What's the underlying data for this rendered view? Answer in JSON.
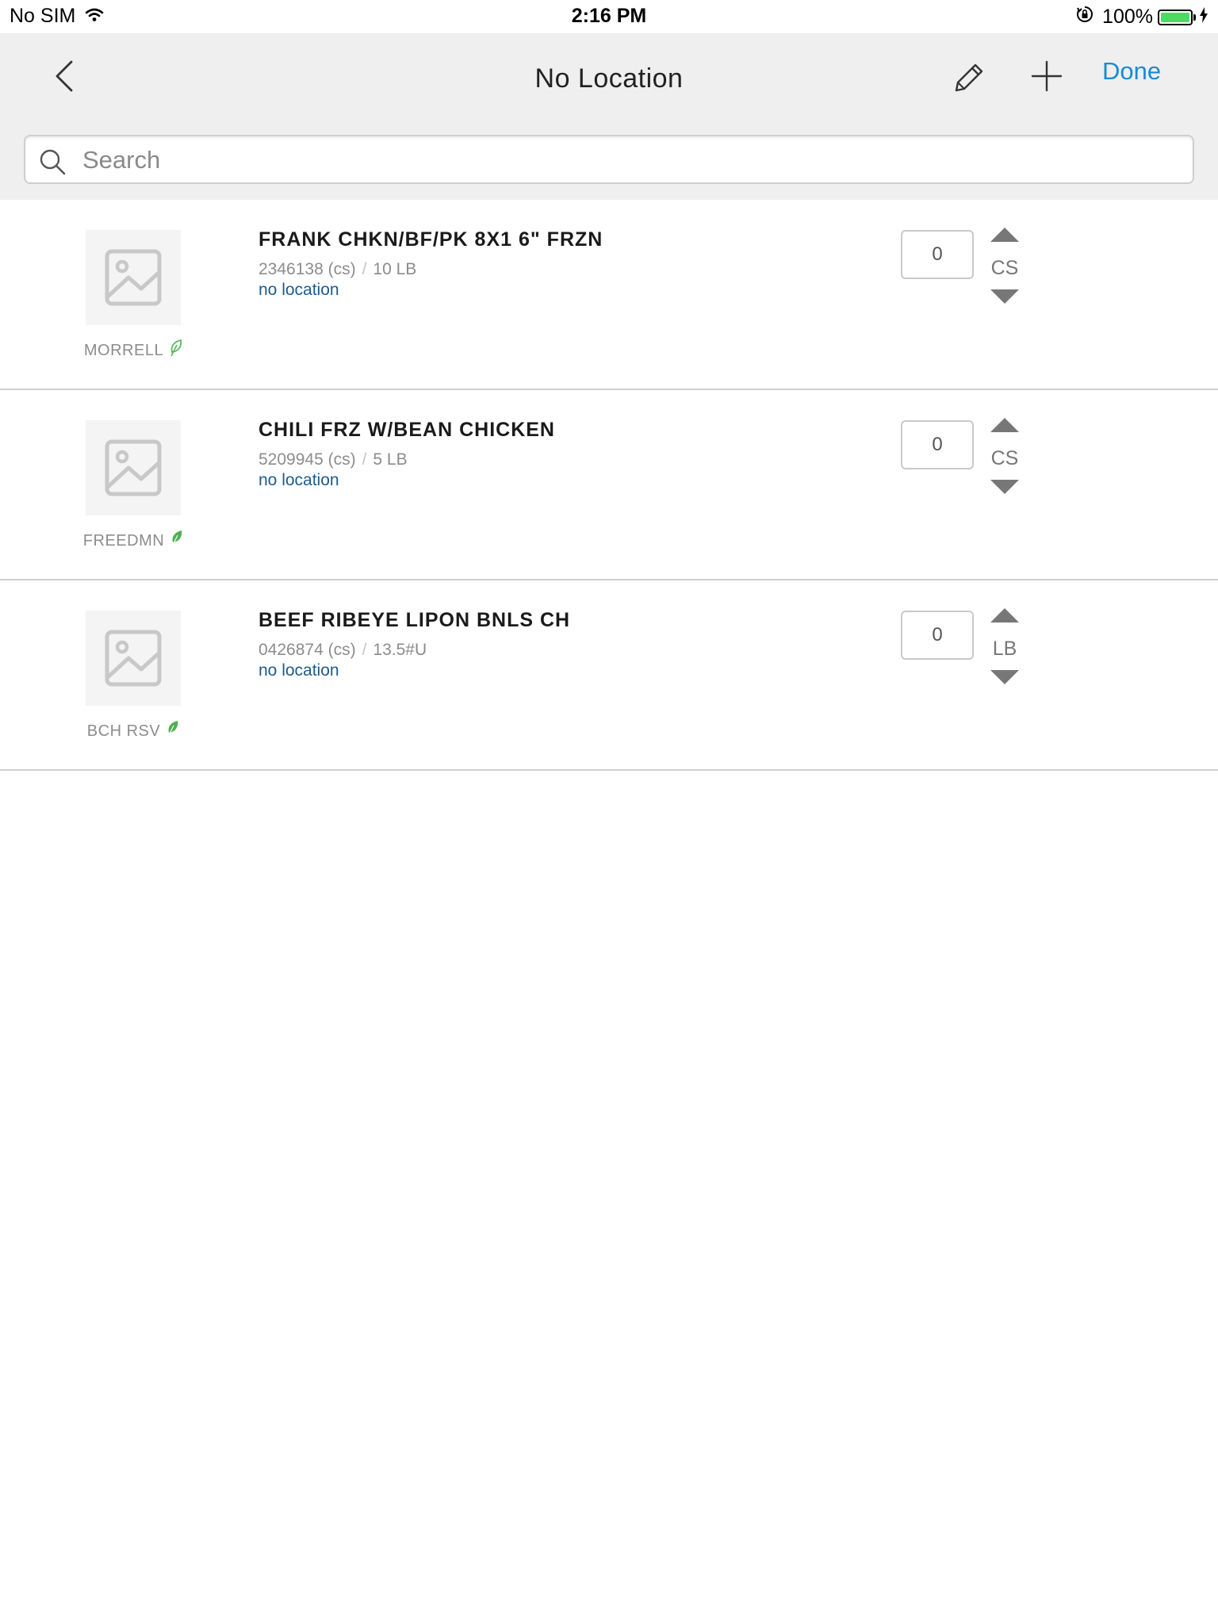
{
  "status_bar": {
    "carrier": "No SIM",
    "time": "2:16 PM",
    "battery_percent": "100%",
    "battery_level": 1.0,
    "battery_color": "#4cd964"
  },
  "nav": {
    "title": "No Location",
    "done_label": "Done",
    "accent_color": "#1a8ad4",
    "icons": [
      "chevron-left-icon",
      "pencil-icon",
      "plus-icon"
    ]
  },
  "search": {
    "placeholder": "Search",
    "value": ""
  },
  "items": [
    {
      "name": "FRANK CHKN/BF/PK 8X1 6\" FRZN",
      "code": "2346138 (cs)",
      "pack": "10 LB",
      "location": "no location",
      "brand": "MORRELL",
      "leaf_style": "outline",
      "quantity": "0",
      "unit": "CS"
    },
    {
      "name": "CHILI FRZ W/BEAN CHICKEN",
      "code": "5209945 (cs)",
      "pack": "5 LB",
      "location": "no location",
      "brand": "FREEDMN",
      "leaf_style": "filled",
      "quantity": "0",
      "unit": "CS"
    },
    {
      "name": "BEEF RIBEYE LIPON BNLS CH",
      "code": "0426874 (cs)",
      "pack": "13.5#U",
      "location": "no location",
      "brand": "BCH RSV",
      "leaf_style": "filled",
      "quantity": "0",
      "unit": "LB"
    }
  ]
}
